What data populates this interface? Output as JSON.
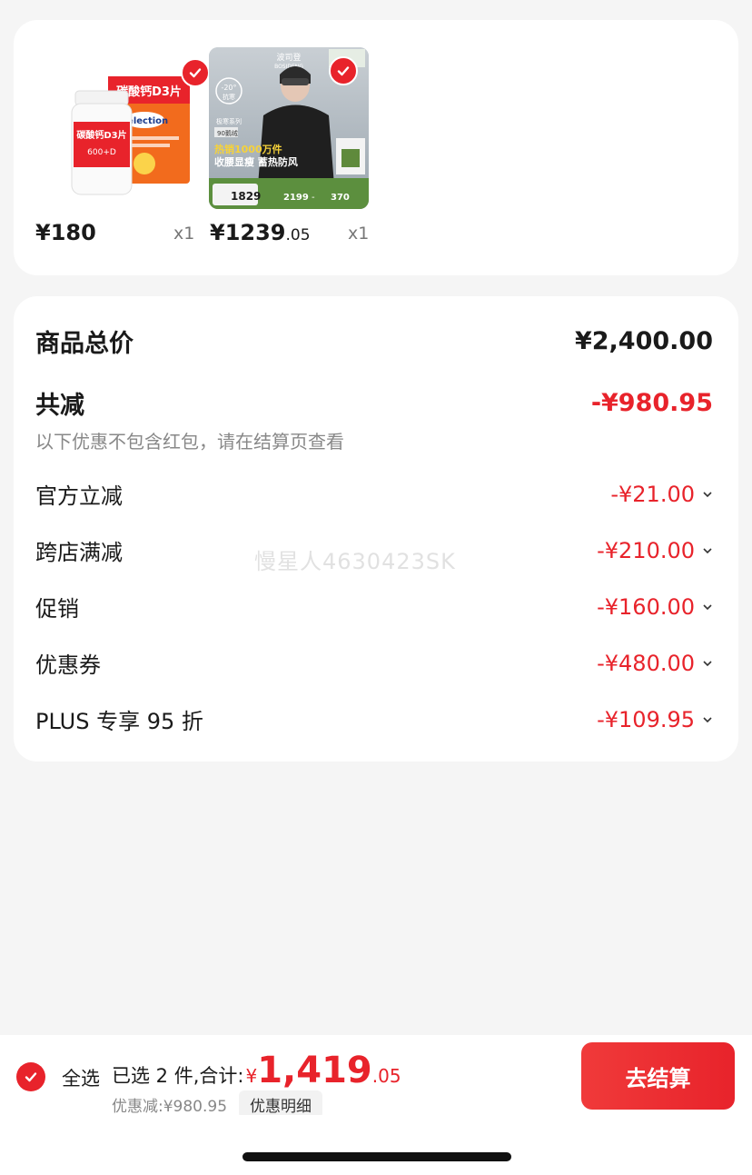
{
  "products": [
    {
      "name": "碳酸钙D3片",
      "box_text": [
        "碳酸钙D3片",
        "Selection",
        "600+D"
      ],
      "price": "¥180",
      "qty": "x1"
    },
    {
      "name": "波司登羽绒服",
      "banner_text": {
        "brand": "波司登",
        "brand_en": "BOSIDENG",
        "temp": "-20°",
        "temp_label": "抗寒",
        "series": "极寒系列",
        "down": "90鹅绒",
        "sold": "热销1000万件",
        "slogan": "收腰显瘦 蓄热防风",
        "price_a": "1829",
        "price_b": "2199",
        "dash": "-",
        "price_c": "370"
      },
      "price_int": "¥1239",
      "price_dec": ".05",
      "qty": "x1"
    }
  ],
  "summary": {
    "total_label": "商品总价",
    "total_value": "¥2,400.00",
    "reduce_label": "共减",
    "reduce_value": "-¥980.95",
    "note": "以下优惠不包含红包，请在结算页查看",
    "items": [
      {
        "label": "官方立减",
        "value": "-¥21.00"
      },
      {
        "label": "跨店满减",
        "value": "-¥210.00"
      },
      {
        "label": "促销",
        "value": "-¥160.00"
      },
      {
        "label": "优惠券",
        "value": "-¥480.00"
      },
      {
        "label": "PLUS 专享 95 折",
        "value": "-¥109.95"
      }
    ]
  },
  "watermark": "慢星人4630423SK",
  "bottom": {
    "select_all": "全选",
    "selected_text": "已选 2 件,合计:",
    "yen": "¥",
    "amount": "1,419",
    "cents": ".05",
    "discount": "优惠减:¥980.95",
    "detail": "优惠明细",
    "checkout": "去结算"
  },
  "colors": {
    "accent": "#e8232b",
    "background": "#f5f5f5"
  }
}
